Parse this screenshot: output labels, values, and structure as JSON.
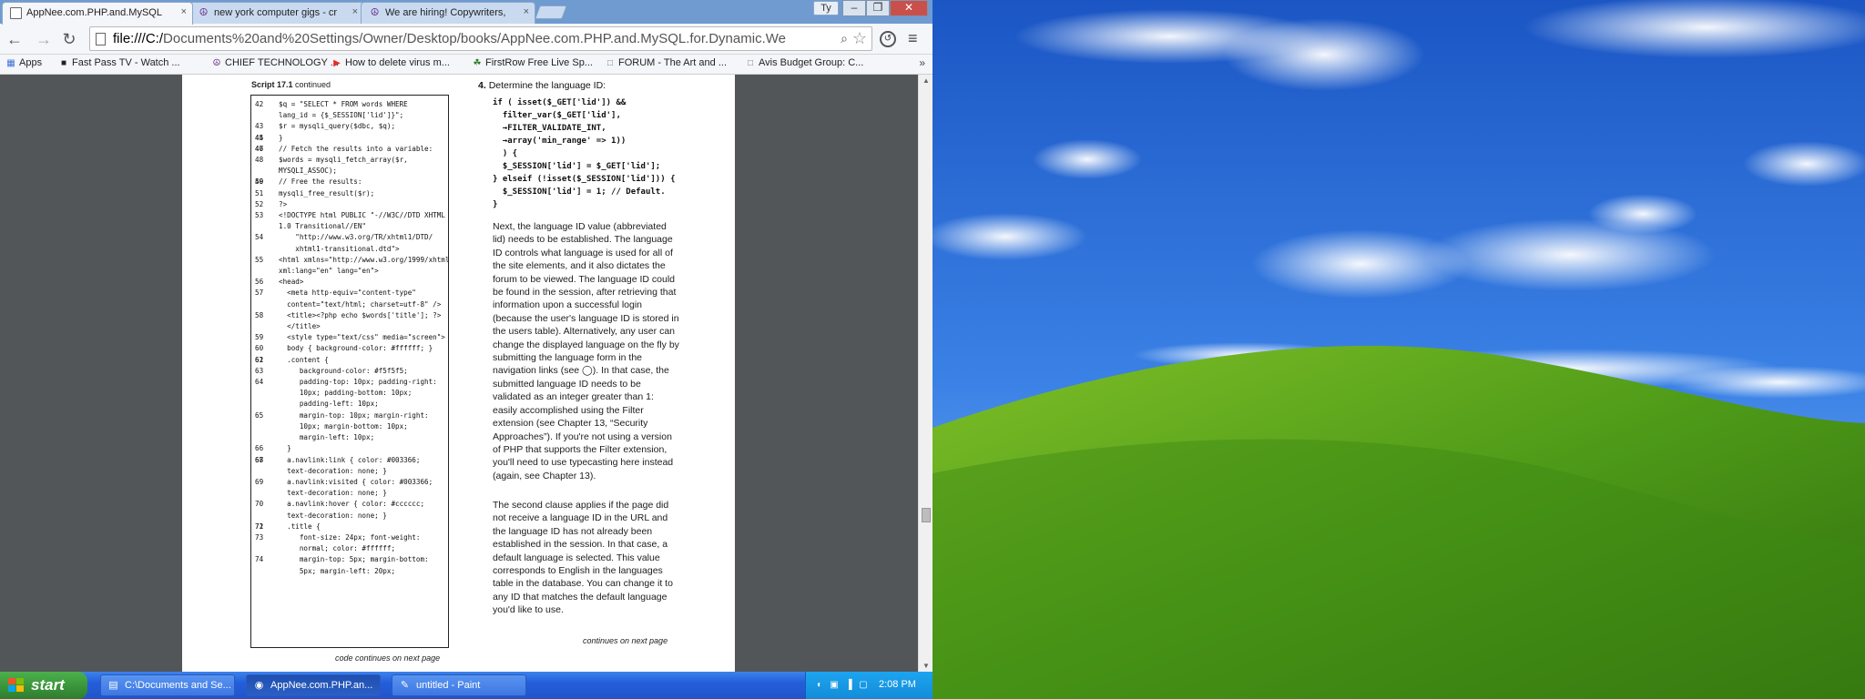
{
  "window": {
    "user": "Ty",
    "min_label": "–",
    "max_label": "❐",
    "close_label": "✕"
  },
  "tabs": [
    {
      "label": "AppNee.com.PHP.and.MySQL",
      "icon": "page-icon",
      "close": "×"
    },
    {
      "label": "new york computer gigs - cr",
      "icon": "peace-icon",
      "close": "×"
    },
    {
      "label": "We are hiring! Copywriters,",
      "icon": "peace-icon",
      "close": "×"
    }
  ],
  "nav": {
    "back": "←",
    "forward": "→",
    "reload": "↻"
  },
  "omnibox": {
    "url_prefix": "file:///C:/",
    "url_rest": "Documents%20and%20Settings/Owner/Desktop/books/AppNee.com.PHP.and.MySQL.for.Dynamic.We",
    "zoom": "⌕",
    "star": "☆"
  },
  "toolbar_icons": {
    "extension": "↺",
    "menu": "≡"
  },
  "bookmarks": [
    {
      "label": "Apps",
      "icon": "▦",
      "color": "#3b6fd6"
    },
    {
      "label": "Fast Pass TV - Watch ...",
      "icon": "■",
      "color": "#222222"
    },
    {
      "label": "CHIEF TECHNOLOGY ...",
      "icon": "☮",
      "color": "#6a2a8a"
    },
    {
      "label": "How to delete virus m...",
      "icon": "▶",
      "color": "#e52d27"
    },
    {
      "label": "FirstRow Free Live Sp...",
      "icon": "☘",
      "color": "#2c7d2c"
    },
    {
      "label": "FORUM - The Art and ...",
      "icon": "□",
      "color": "#777777"
    },
    {
      "label": "Avis Budget Group: C...",
      "icon": "□",
      "color": "#777777"
    }
  ],
  "bookmarks_more": "»",
  "document": {
    "script_caption_bold": "Script 17.1",
    "script_caption_rest": " continued",
    "code_lines": [
      {
        "n": "42",
        "t": "$q = \"SELECT * FROM words WHERE"
      },
      {
        "n": "",
        "t": "lang_id = {$_SESSION['lid']}\";"
      },
      {
        "n": "43",
        "t": "$r = mysqli_query($dbc, $q);"
      },
      {
        "n": "44",
        "t": ""
      },
      {
        "n": "45",
        "t": "}"
      },
      {
        "n": "46",
        "t": ""
      },
      {
        "n": "47",
        "t": "// Fetch the results into a variable:"
      },
      {
        "n": "48",
        "t": "$words = mysqli_fetch_array($r,"
      },
      {
        "n": "",
        "t": "MYSQLI_ASSOC);"
      },
      {
        "n": "49",
        "t": ""
      },
      {
        "n": "50",
        "t": "// Free the results:"
      },
      {
        "n": "51",
        "t": "mysqli_free_result($r);"
      },
      {
        "n": "52",
        "t": "?>"
      },
      {
        "n": "53",
        "t": "<!DOCTYPE html PUBLIC \"-//W3C//DTD XHTML"
      },
      {
        "n": "",
        "t": "1.0 Transitional//EN\""
      },
      {
        "n": "54",
        "t": "    \"http://www.w3.org/TR/xhtml1/DTD/"
      },
      {
        "n": "",
        "t": "    xhtml1-transitional.dtd\">"
      },
      {
        "n": "55",
        "t": "<html xmlns=\"http://www.w3.org/1999/xhtml\""
      },
      {
        "n": "",
        "t": "xml:lang=\"en\" lang=\"en\">"
      },
      {
        "n": "56",
        "t": "<head>"
      },
      {
        "n": "57",
        "t": "  <meta http-equiv=\"content-type\""
      },
      {
        "n": "",
        "t": "  content=\"text/html; charset=utf-8\" />"
      },
      {
        "n": "58",
        "t": "  <title><?php echo $words['title']; ?>"
      },
      {
        "n": "",
        "t": "  </title>"
      },
      {
        "n": "59",
        "t": "  <style type=\"text/css\" media=\"screen\">"
      },
      {
        "n": "60",
        "t": "  body { background-color: #ffffff; }"
      },
      {
        "n": "61",
        "t": ""
      },
      {
        "n": "62",
        "t": "  .content {"
      },
      {
        "n": "63",
        "t": "     background-color: #f5f5f5;"
      },
      {
        "n": "64",
        "t": "     padding-top: 10px; padding-right:"
      },
      {
        "n": "",
        "t": "     10px; padding-bottom: 10px;"
      },
      {
        "n": "",
        "t": "     padding-left: 10px;"
      },
      {
        "n": "65",
        "t": "     margin-top: 10px; margin-right:"
      },
      {
        "n": "",
        "t": "     10px; margin-bottom: 10px;"
      },
      {
        "n": "",
        "t": "     margin-left: 10px;"
      },
      {
        "n": "66",
        "t": "  }"
      },
      {
        "n": "67",
        "t": ""
      },
      {
        "n": "68",
        "t": "  a.navlink:link { color: #003366;"
      },
      {
        "n": "",
        "t": "  text-decoration: none; }"
      },
      {
        "n": "69",
        "t": "  a.navlink:visited { color: #003366;"
      },
      {
        "n": "",
        "t": "  text-decoration: none; }"
      },
      {
        "n": "70",
        "t": "  a.navlink:hover { color: #cccccc;"
      },
      {
        "n": "",
        "t": "  text-decoration: none; }"
      },
      {
        "n": "71",
        "t": ""
      },
      {
        "n": "72",
        "t": "  .title {"
      },
      {
        "n": "73",
        "t": "     font-size: 24px; font-weight:"
      },
      {
        "n": "",
        "t": "     normal; color: #ffffff;"
      },
      {
        "n": "74",
        "t": "     margin-top: 5px; margin-bottom:"
      },
      {
        "n": "",
        "t": "     5px; margin-left: 20px;"
      }
    ],
    "code_continues": "code continues on next page",
    "step_number": "4.",
    "step_title": "Determine the language ID:",
    "step_code": [
      "if ( isset($_GET['lid']) &&",
      "  filter_var($_GET['lid'],",
      "  →FILTER_VALIDATE_INT,",
      "  →array('min_range' => 1))",
      "  ) {",
      "  $_SESSION['lid'] = $_GET['lid'];",
      "} elseif (!isset($_SESSION['lid'])) {",
      "  $_SESSION['lid'] = 1; // Default.",
      "}"
    ],
    "para1": "Next, the language ID value (abbreviated lid) needs to be established. The language ID controls what language is used for all of the site elements, and it also dictates the forum to be viewed. The language ID could be found in the session, after retrieving that information upon a successful login (because the user's language ID is stored in the users table). Alternatively, any user can change the displayed language on the fly by submitting the language form in the navigation links (see ◯). In that case, the submitted language ID needs to be validated as an integer greater than 1: easily accomplished using the Filter extension (see Chapter 13, “Security Approaches”). If you're not using a version of PHP that supports the Filter extension, you'll need to use typecasting here instead (again, see Chapter 13).",
    "para2": "The second clause applies if the page did not receive a language ID in the URL and the language ID has not already been established in the session. In that case, a default language is selected. This value corresponds to English in the languages table in the database. You can change it to any ID that matches the default language you'd like to use.",
    "continues_next": "continues on next page"
  },
  "pdf_tools": [
    {
      "name": "fit-page-icon",
      "glyph": "⛶"
    },
    {
      "name": "rotate-icon",
      "glyph": "⮌"
    },
    {
      "name": "zoom-out-icon",
      "glyph": "⊖"
    },
    {
      "name": "zoom-in-icon",
      "glyph": "⊕"
    },
    {
      "name": "save-icon",
      "glyph": "▣"
    },
    {
      "name": "print-icon",
      "glyph": "⎙"
    }
  ],
  "taskbar": {
    "start_label": "start",
    "tasks": [
      {
        "label": "C:\\Documents and Se...",
        "icon": "▤",
        "active": false
      },
      {
        "label": "AppNee.com.PHP.an...",
        "icon": "◉",
        "active": true
      },
      {
        "label": "untitled - Paint",
        "icon": "✎",
        "active": false
      }
    ],
    "tray_icons": [
      "◐",
      "▣",
      "▐",
      "▢"
    ],
    "clock": "2:08 PM"
  },
  "colors": {
    "taskbar_blue": "#245edb",
    "start_green": "#3a943a",
    "tray_blue": "#138cd9",
    "viewer_gray": "#525659",
    "sky": "#2f6fd8",
    "grass": "#4f9a1a"
  }
}
